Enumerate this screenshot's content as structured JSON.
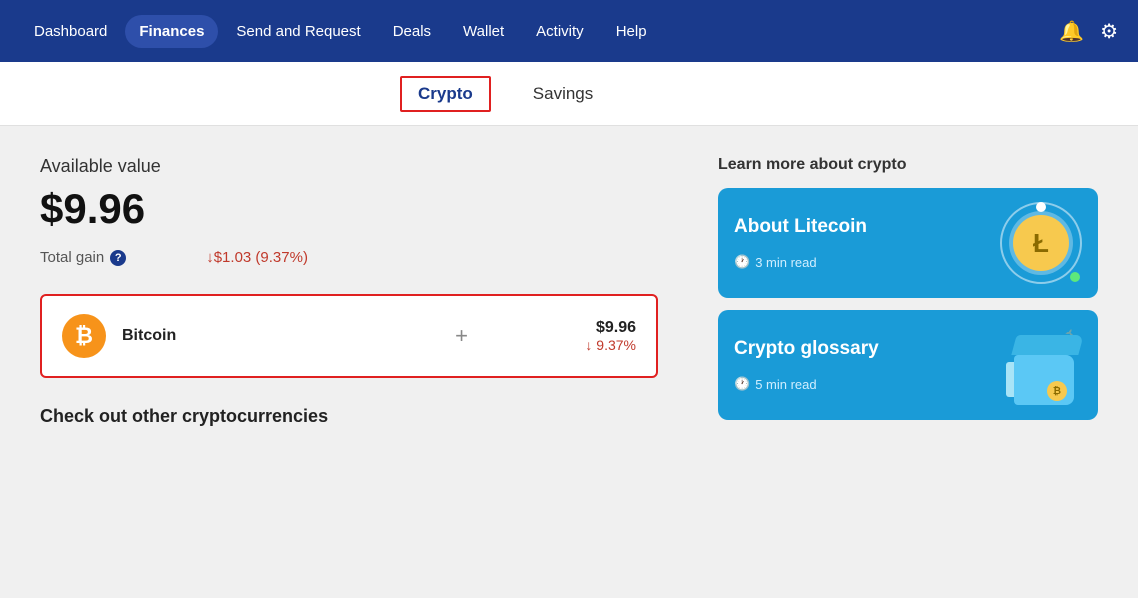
{
  "nav": {
    "items": [
      {
        "id": "dashboard",
        "label": "Dashboard",
        "active": false
      },
      {
        "id": "finances",
        "label": "Finances",
        "active": true
      },
      {
        "id": "send-request",
        "label": "Send and Request",
        "active": false
      },
      {
        "id": "deals",
        "label": "Deals",
        "active": false
      },
      {
        "id": "wallet",
        "label": "Wallet",
        "active": false
      },
      {
        "id": "activity",
        "label": "Activity",
        "active": false
      },
      {
        "id": "help",
        "label": "Help",
        "active": false
      }
    ]
  },
  "subtabs": [
    {
      "id": "crypto",
      "label": "Crypto",
      "active": true
    },
    {
      "id": "savings",
      "label": "Savings",
      "active": false
    }
  ],
  "main": {
    "available_label": "Available value",
    "available_value": "$9.96",
    "total_gain_label": "Total gain",
    "total_gain_value": "↓$1.03 (9.37%)",
    "crypto_name": "Bitcoin",
    "crypto_usd": "$9.96",
    "crypto_pct": "↓ 9.37%",
    "other_cryptos_label": "Check out other cryptocurrencies"
  },
  "learn": {
    "title": "Learn more about crypto",
    "cards": [
      {
        "id": "litecoin",
        "title": "About Litecoin",
        "read_time": "3 min read"
      },
      {
        "id": "glossary",
        "title": "Crypto glossary",
        "read_time": "5 min read"
      }
    ]
  }
}
